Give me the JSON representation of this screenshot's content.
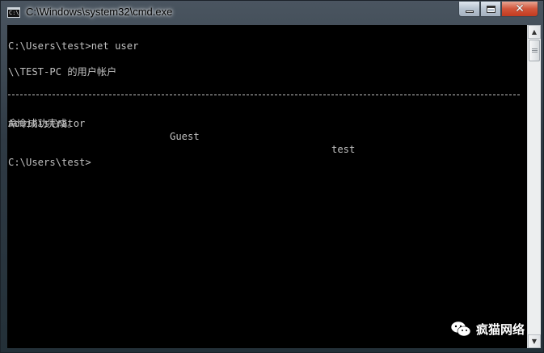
{
  "window": {
    "title": "C:\\Windows\\system32\\cmd.exe",
    "icon_label": "C:\\",
    "controls": {
      "minimize_icon": "minimize-icon",
      "maximize_icon": "maximize-icon",
      "close_icon": "close-icon"
    }
  },
  "console": {
    "prompt_line_1": "C:\\Users\\test>net user",
    "accounts_header": "\\\\TEST-PC 的用户帐户",
    "accounts": [
      "Administrator",
      "Guest",
      "test"
    ],
    "completion_message": "命令成功完成。",
    "prompt_line_2": "C:\\Users\\test>"
  },
  "watermark": {
    "text": "疯猫网络",
    "icon": "wechat-icon"
  },
  "colors": {
    "console_bg": "#000000",
    "console_fg": "#c0c0c0"
  }
}
